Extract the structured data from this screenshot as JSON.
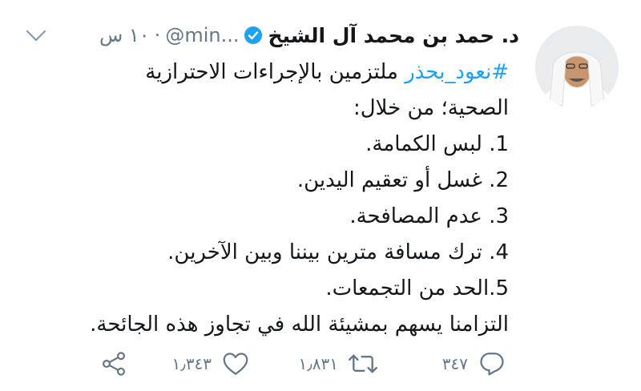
{
  "author": {
    "name": "د. حمد بن محمد آل الشيخ",
    "handle": "@min...",
    "separator": "·",
    "time": "١٠ س"
  },
  "tweet": {
    "hashtag": "#نعود_بحذر",
    "line1_rest": " ملتزمين بالإجراءات الاحترازية",
    "line2": "الصحية؛ من خلال:",
    "line3": "1. لبس الكمامة.",
    "line4": "2. غسل أو تعقيم اليدين.",
    "line5": "3. عدم المصافحة.",
    "line6": "4. ترك مسافة مترين بيننا وبين الآخرين.",
    "line7": "5.الحد من التجمعات.",
    "line8": "التزامنا يسهم بمشيئة الله في تجاوز هذه الجائحة."
  },
  "actions": {
    "reply_count": "٣٤٧",
    "retweet_count": "١٫٨٣١",
    "like_count": "١٫٣٤٣"
  },
  "colors": {
    "accent": "#1da1f2",
    "muted": "#657786",
    "text": "#14171a"
  },
  "icons": {
    "reply": "reply-icon",
    "retweet": "retweet-icon",
    "like": "heart-icon",
    "share": "share-icon",
    "verified": "verified-badge-icon",
    "menu": "chevron-down-icon"
  }
}
